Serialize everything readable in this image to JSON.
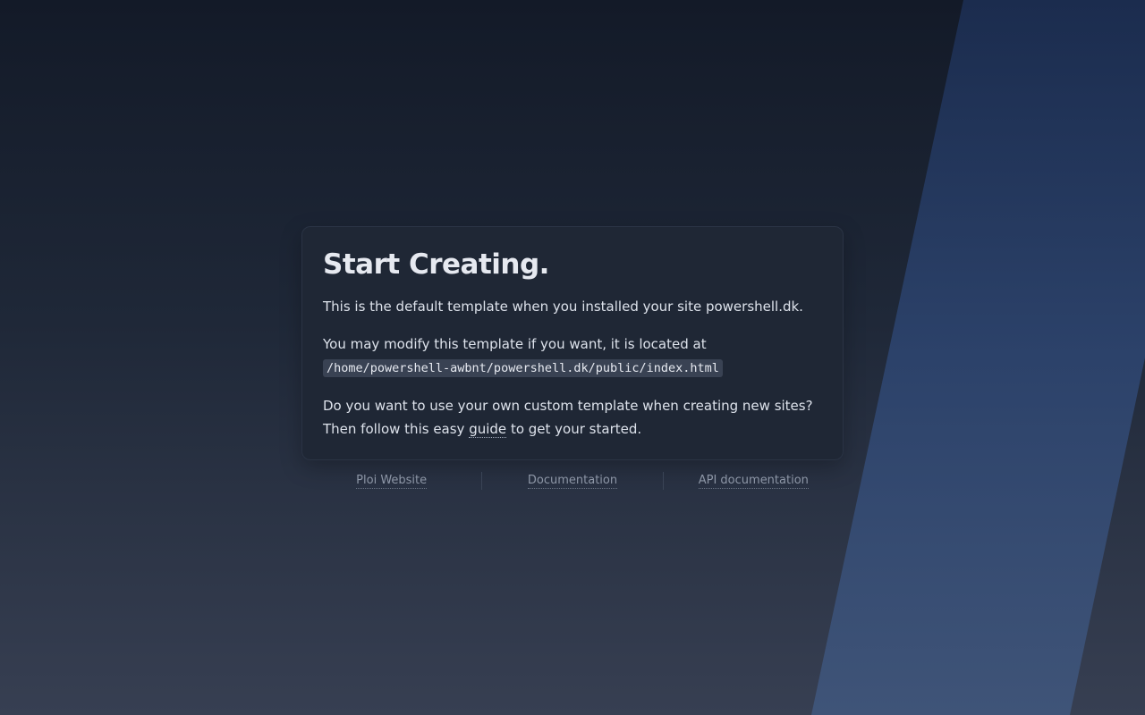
{
  "card": {
    "title": "Start Creating.",
    "intro": "This is the default template when you installed your site powershell.dk.",
    "modify_text": "You may modify this template if you want, it is located at",
    "template_path": "/home/powershell-awbnt/powershell.dk/public/index.html",
    "custom_prefix": "Do you want to use your own custom template when creating new sites? Then follow this easy",
    "guide_link": "guide",
    "custom_suffix": "to get your started."
  },
  "footer": {
    "links": [
      {
        "label": "Ploi Website"
      },
      {
        "label": "Documentation"
      },
      {
        "label": "API documentation"
      }
    ]
  },
  "colors": {
    "background_top": "#131a28",
    "background_bottom": "#373f52",
    "stripe": "#2c426a",
    "card": "#1f2735"
  }
}
